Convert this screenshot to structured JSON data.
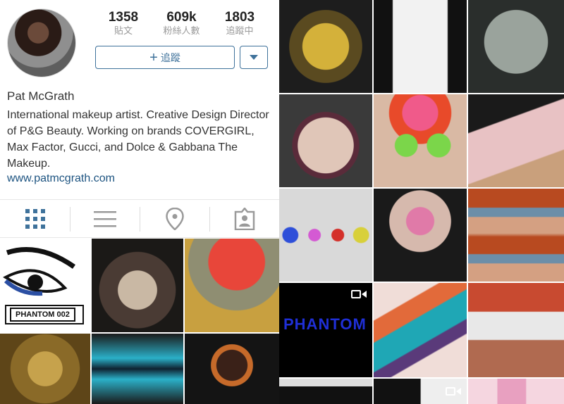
{
  "profile": {
    "name": "Pat McGrath",
    "bio": "International makeup artist. Creative Design Director of P&G Beauty. Working on brands COVERGIRL, Max Factor, Gucci, and Dolce & Gabbana The Makeup.",
    "website": "www.patmcgrath.com",
    "stats": [
      {
        "value": "1358",
        "label": "貼文"
      },
      {
        "value": "609k",
        "label": "粉絲人數"
      },
      {
        "value": "1803",
        "label": "追蹤中"
      }
    ],
    "follow_button": {
      "icon": "+",
      "label": "追蹤"
    },
    "dropdown_icon": "chevron-down-icon"
  },
  "tabs": [
    {
      "name": "grid-view",
      "icon": "grid-icon",
      "active": true
    },
    {
      "name": "list-view",
      "icon": "list-icon"
    },
    {
      "name": "places",
      "icon": "location-pin-icon"
    },
    {
      "name": "tagged",
      "icon": "tagged-person-icon"
    }
  ],
  "posts_left": [
    {
      "id": "p1",
      "video": true,
      "caption": "PHANTOM 002"
    },
    {
      "id": "p2"
    },
    {
      "id": "p3"
    },
    {
      "id": "p4"
    },
    {
      "id": "p5"
    },
    {
      "id": "p6"
    }
  ],
  "posts_right": [
    {
      "id": "r1"
    },
    {
      "id": "r2"
    },
    {
      "id": "r3"
    },
    {
      "id": "r4"
    },
    {
      "id": "r5"
    },
    {
      "id": "r6"
    },
    {
      "id": "r7"
    },
    {
      "id": "r8"
    },
    {
      "id": "r9"
    },
    {
      "id": "r10",
      "video": true,
      "caption": "PHANTOM"
    },
    {
      "id": "r11"
    },
    {
      "id": "r12"
    },
    {
      "id": "r13"
    },
    {
      "id": "r14",
      "video": true
    },
    {
      "id": "r15"
    }
  ],
  "colors": {
    "accent": "#3f729b",
    "link": "#1c5380",
    "muted": "#9a9a9a"
  }
}
